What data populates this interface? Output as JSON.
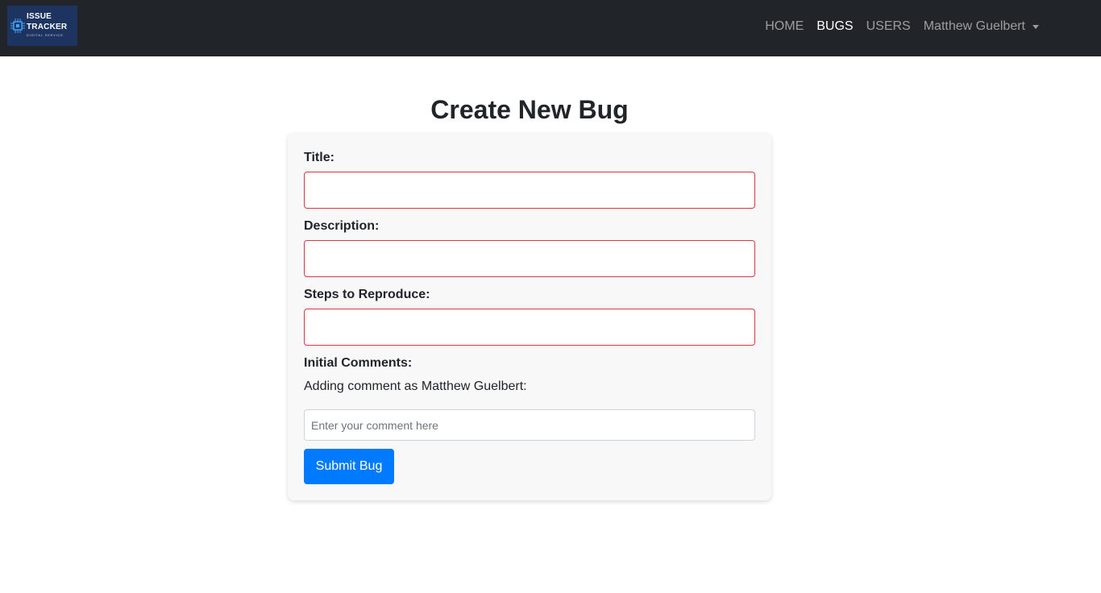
{
  "brand": {
    "line1": "ISSUE",
    "line2": "TRACKER",
    "line3": "DIGITAL SERVICE",
    "bg_color": "#1d3461",
    "icon": "circuit-chip-icon"
  },
  "nav": {
    "items": [
      {
        "label": "HOME",
        "active": false
      },
      {
        "label": "BUGS",
        "active": true
      },
      {
        "label": "USERS",
        "active": false
      }
    ],
    "user": {
      "label": "Matthew Guelbert",
      "icon": "caret-down-icon"
    }
  },
  "page": {
    "title": "Create New Bug"
  },
  "form": {
    "title_label": "Title:",
    "title_value": "",
    "description_label": "Description:",
    "description_value": "",
    "steps_label": "Steps to Reproduce:",
    "steps_value": "",
    "comments_label": "Initial Comments:",
    "comment_note": "Adding comment as Matthew Guelbert:",
    "comment_placeholder": "Enter your comment here",
    "comment_value": "",
    "submit_label": "Submit Bug"
  },
  "colors": {
    "navbar": "#212529",
    "invalid_border": "#dc3545",
    "primary": "#007bff",
    "card": "#f8f8f8"
  }
}
